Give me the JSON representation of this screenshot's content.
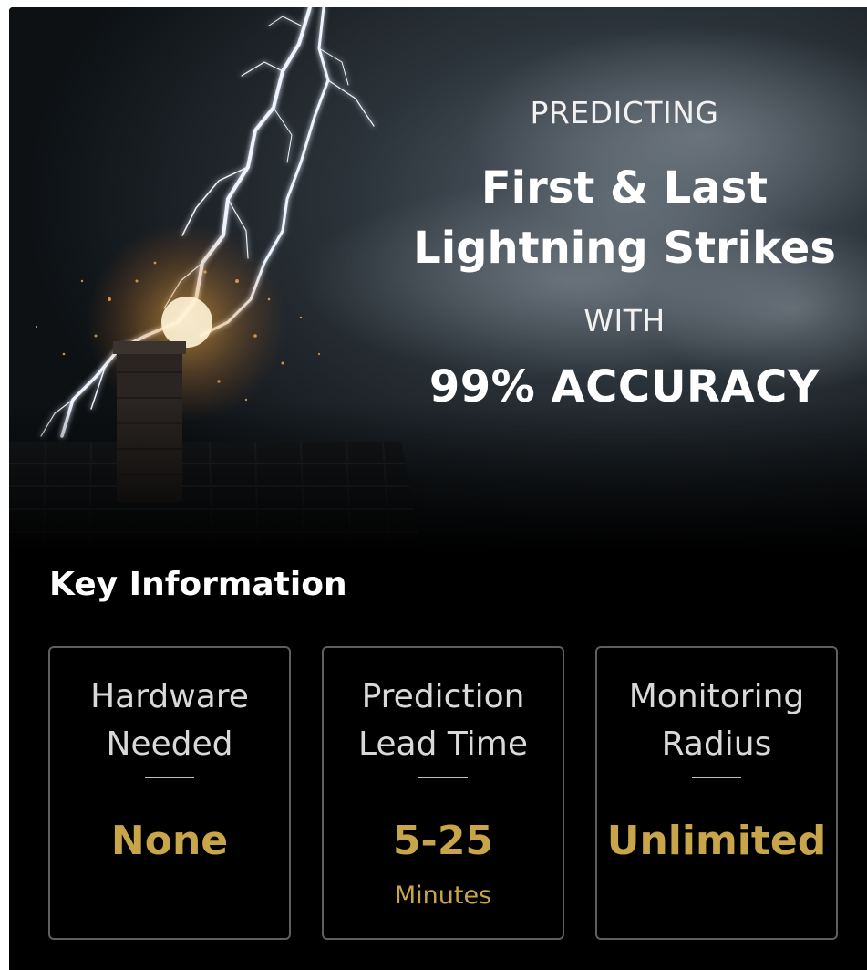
{
  "hero": {
    "eyebrow_top": "PREDICTING",
    "headline_line1": "First & Last",
    "headline_line2": "Lightning Strikes",
    "eyebrow_bottom": "WITH",
    "accuracy": "99% ACCURACY"
  },
  "key_info": {
    "title": "Key Information",
    "items": [
      {
        "label_line1": "Hardware",
        "label_line2": "Needed",
        "value": "None",
        "unit": ""
      },
      {
        "label_line1": "Prediction",
        "label_line2": "Lead Time",
        "value": "5-25",
        "unit": "Minutes"
      },
      {
        "label_line1": "Monitoring",
        "label_line2": "Radius",
        "value": "Unlimited",
        "unit": ""
      }
    ]
  },
  "colors": {
    "background": "#000000",
    "accent_gold": "#c9a54a",
    "box_border": "#5f5f5f"
  }
}
